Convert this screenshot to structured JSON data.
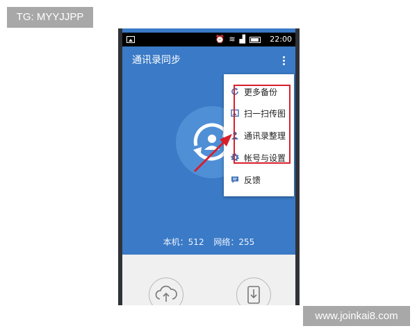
{
  "watermarks": {
    "top_left": "TG: MYYJJPP",
    "bottom_right": "www.joinkai8.com"
  },
  "status_bar": {
    "time": "22:00",
    "icons": [
      "image-icon",
      "alarm-icon",
      "wifi-icon",
      "signal-icon",
      "battery-icon"
    ]
  },
  "app_bar": {
    "title": "通讯录同步",
    "menu_icon": "overflow-menu-icon"
  },
  "hero": {
    "icon": "sync-contact-icon",
    "local_label": "本机：512",
    "network_label": "网络：255"
  },
  "bottom_actions": [
    {
      "icon": "cloud-upload-icon"
    },
    {
      "icon": "phone-download-icon"
    }
  ],
  "menu": {
    "items": [
      {
        "label": "更多备份",
        "icon": "refresh-icon"
      },
      {
        "label": "扫一扫传图",
        "icon": "image-icon"
      },
      {
        "label": "通讯录整理",
        "icon": "person-icon"
      },
      {
        "label": "帐号与设置",
        "icon": "gear-icon"
      },
      {
        "label": "反馈",
        "icon": "chat-icon"
      }
    ]
  },
  "colors": {
    "primary": "#3a7ac6",
    "highlight": "#d91e2a",
    "menu_icon": "#3a6fb5"
  }
}
